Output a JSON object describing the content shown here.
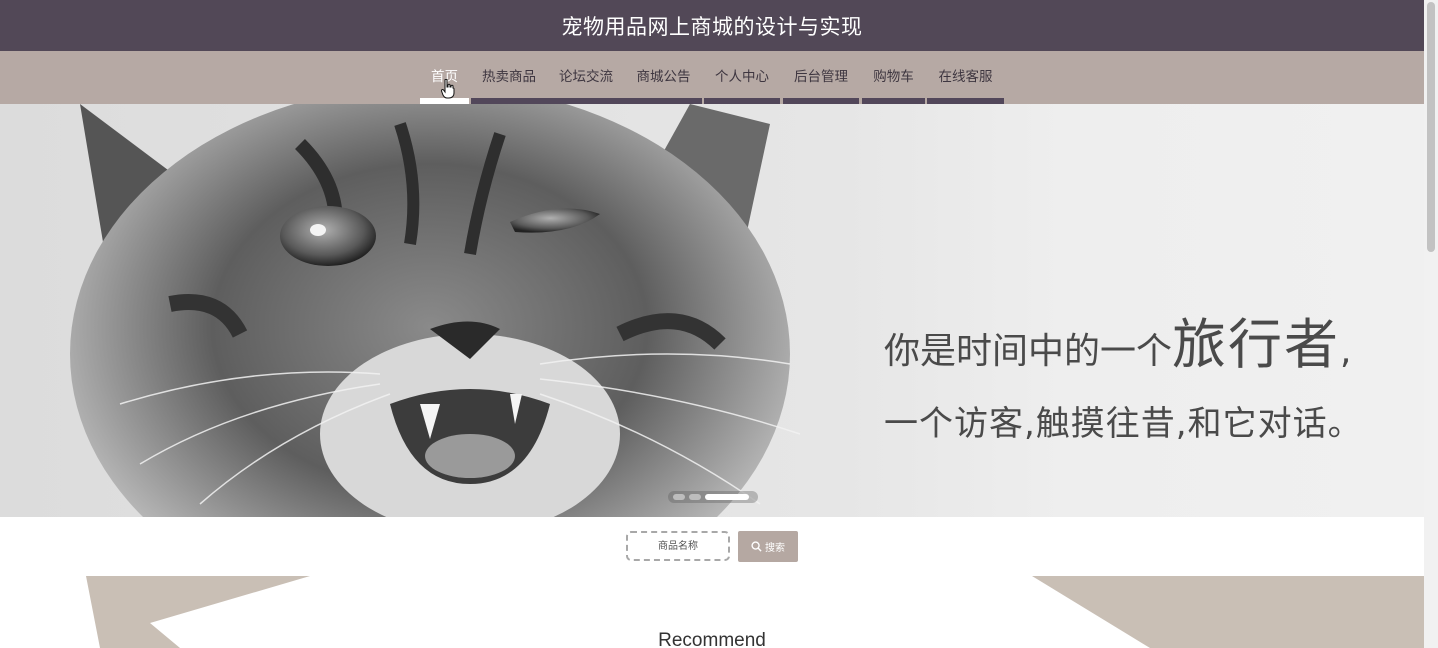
{
  "header": {
    "title": "宠物用品网上商城的设计与实现"
  },
  "nav": {
    "items": [
      {
        "label": "首页",
        "active": true
      },
      {
        "label": "热卖商品"
      },
      {
        "label": "论坛交流"
      },
      {
        "label": "商城公告"
      },
      {
        "label": "个人中心"
      },
      {
        "label": "后台管理"
      },
      {
        "label": "购物车"
      },
      {
        "label": "在线客服"
      }
    ]
  },
  "banner": {
    "line1_prefix": "你是时间中的一个",
    "line1_emphasis": "旅行者",
    "line1_suffix": ",",
    "line2": "一个访客,触摸往昔,和它对话。",
    "slides_total": 3,
    "active_slide": 3
  },
  "search": {
    "placeholder": "商品名称",
    "button_label": "搜索"
  },
  "recommend": {
    "title": "Recommend"
  },
  "colors": {
    "header_bg": "#524857",
    "nav_bg": "#b6a9a4",
    "accent": "#b5a8a2",
    "decor": "#c9bfb5"
  },
  "icons": [
    "pointer-cursor-icon",
    "search-icon"
  ]
}
